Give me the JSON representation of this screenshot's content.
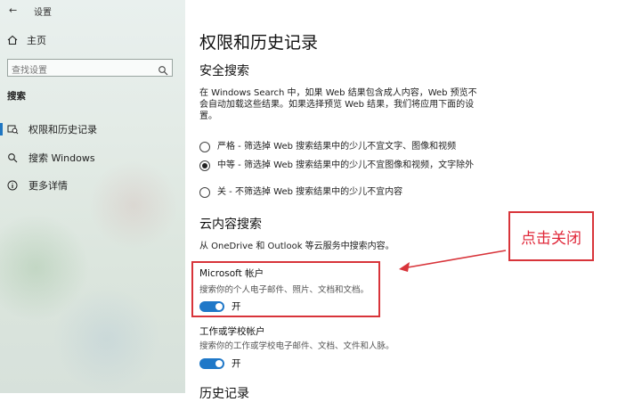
{
  "window": {
    "back_glyph": "←",
    "title": "设置"
  },
  "sidebar": {
    "home_label": "主页",
    "search_placeholder": "查找设置",
    "section": "搜索",
    "items": [
      {
        "label": "权限和历史记录",
        "icon": "search-history-icon",
        "active": true
      },
      {
        "label": "搜索 Windows",
        "icon": "search-icon",
        "active": false
      },
      {
        "label": "更多详情",
        "icon": "info-icon",
        "active": false
      }
    ]
  },
  "main": {
    "title": "权限和历史记录",
    "safe_search": {
      "heading": "安全搜索",
      "description": "在 Windows Search 中，如果 Web 结果包含成人内容，Web 预览不会自动加载这些结果。如果选择预览 Web 结果，我们将应用下面的设置。",
      "options": [
        {
          "label": "严格 - 筛选掉 Web 搜索结果中的少儿不宜文字、图像和视频",
          "selected": false
        },
        {
          "label": "中等 - 筛选掉 Web 搜索结果中的少儿不宜图像和视频，文字除外",
          "selected": true
        },
        {
          "label": "关 - 不筛选掉 Web 搜索结果中的少儿不宜内容",
          "selected": false
        }
      ]
    },
    "cloud_search": {
      "heading": "云内容搜索",
      "description": "从 OneDrive 和 Outlook 等云服务中搜索内容。",
      "microsoft_account": {
        "title": "Microsoft 帐户",
        "desc": "搜索你的个人电子邮件、照片、文档和文档。",
        "toggle_label": "开",
        "on": true
      },
      "work_account": {
        "title": "工作或学校帐户",
        "desc": "搜索你的工作或学校电子邮件、文档、文件和人脉。",
        "toggle_label": "开",
        "on": true
      }
    },
    "history_heading": "历史记录"
  },
  "annotation": {
    "text": "点击关闭",
    "color": "#d8343a"
  }
}
